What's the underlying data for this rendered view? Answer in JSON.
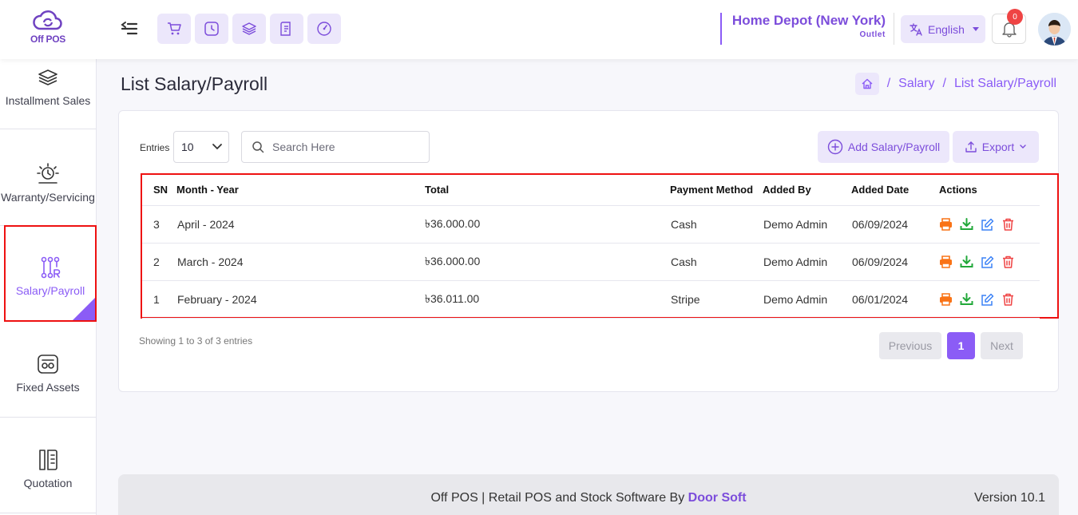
{
  "app": {
    "logo_text": "Off POS"
  },
  "header": {
    "outlet_name": "Home Depot (New York)",
    "outlet_sub": "Outlet",
    "language": "English",
    "notification_count": "0"
  },
  "sidebar": {
    "items": [
      {
        "label": "Installment Sales",
        "icon": "layers-icon"
      },
      {
        "label": "Warranty/Servicing",
        "icon": "warranty-icon"
      },
      {
        "label": "Salary/Payroll",
        "icon": "payroll-icon",
        "active": true
      },
      {
        "label": "Fixed Assets",
        "icon": "assets-icon"
      },
      {
        "label": "Quotation",
        "icon": "quotation-icon"
      }
    ]
  },
  "page": {
    "title": "List Salary/Payroll",
    "breadcrumb": {
      "sep": "/",
      "level1": "Salary",
      "level2": "List Salary/Payroll"
    }
  },
  "controls": {
    "entries_label": "Entries",
    "entries_value": "10",
    "search_placeholder": "Search Here",
    "add_button": "Add Salary/Payroll",
    "export_button": "Export"
  },
  "table": {
    "columns": [
      "SN",
      "Month - Year",
      "Total",
      "Payment Method",
      "Added By",
      "Added Date",
      "Actions"
    ],
    "rows": [
      {
        "sn": "3",
        "month_year": "April - 2024",
        "total": "৳36.000.00",
        "method": "Cash",
        "added_by": "Demo Admin",
        "date": "06/09/2024"
      },
      {
        "sn": "2",
        "month_year": "March - 2024",
        "total": "৳36.000.00",
        "method": "Cash",
        "added_by": "Demo Admin",
        "date": "06/09/2024"
      },
      {
        "sn": "1",
        "month_year": "February - 2024",
        "total": "৳36.011.00",
        "method": "Stripe",
        "added_by": "Demo Admin",
        "date": "06/01/2024"
      }
    ]
  },
  "pagination": {
    "showing": "Showing 1 to 3 of 3 entries",
    "previous": "Previous",
    "current": "1",
    "next": "Next"
  },
  "footer": {
    "text": "Off POS | Retail POS and Stock Software By ",
    "brand": "Door Soft",
    "version": "Version 10.1"
  },
  "colors": {
    "accent": "#8b5cf6",
    "accent_light": "#ece7fb",
    "print": "#f97316",
    "download": "#22a83a",
    "edit": "#3b82f6",
    "delete": "#ef4444"
  }
}
